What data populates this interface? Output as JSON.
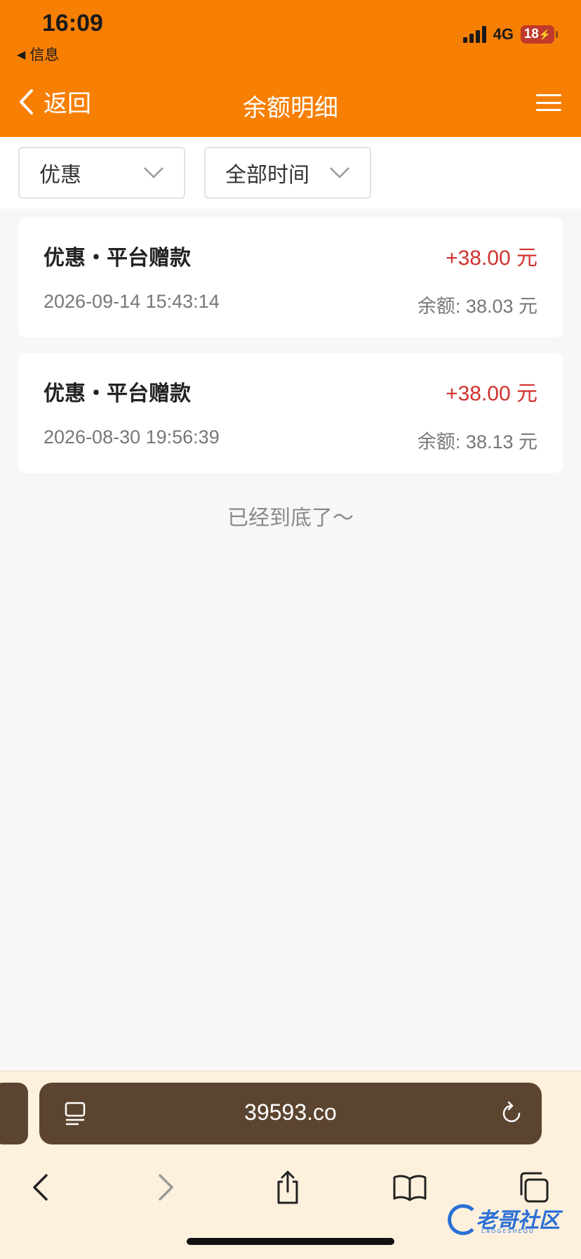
{
  "status_bar": {
    "time": "16:09",
    "back_app": "信息",
    "network": "4G",
    "battery": "18"
  },
  "nav": {
    "back_label": "返回",
    "title": "余额明细"
  },
  "filters": [
    {
      "label": "优惠"
    },
    {
      "label": "全部时间"
    }
  ],
  "records": [
    {
      "title": "优惠・平台赠款",
      "amount": "+38.00 元",
      "time": "2026-09-14 15:43:14",
      "balance": "余额: 38.03 元"
    },
    {
      "title": "优惠・平台赠款",
      "amount": "+38.00 元",
      "time": "2026-08-30 19:56:39",
      "balance": "余额: 38.13 元"
    }
  ],
  "end_text": "已经到底了～",
  "browser": {
    "url": "39593.co"
  },
  "watermark": {
    "title": "老哥社区",
    "subtitle": "LAOGESHEQU"
  },
  "colors": {
    "header": "#f77f04",
    "amount": "#d0322e",
    "url_bar": "#5c4530",
    "browser_bg": "#fdf1de"
  }
}
